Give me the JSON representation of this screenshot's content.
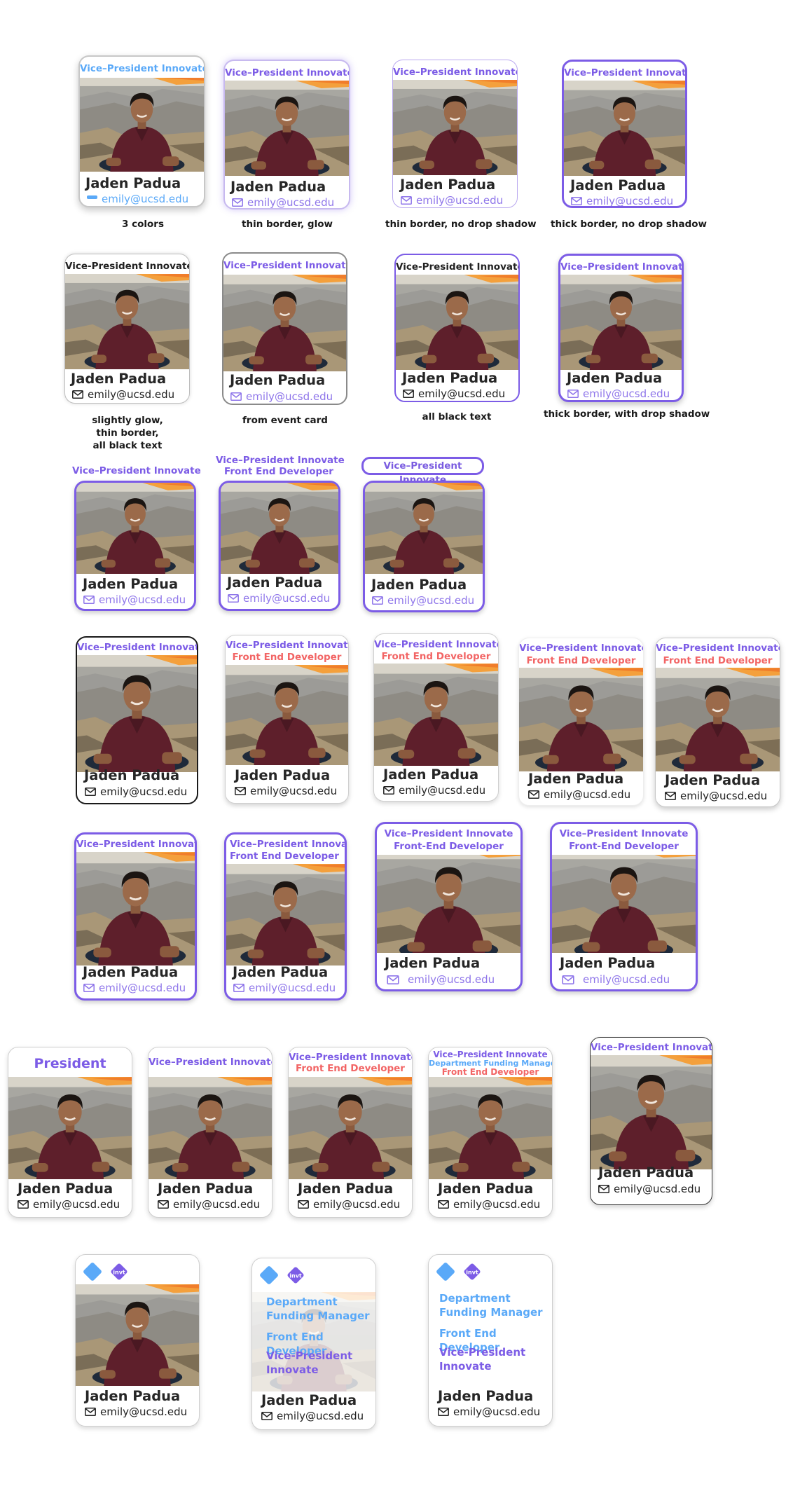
{
  "person": {
    "name": "Jaden Padua",
    "email": "emily@ucsd.edu"
  },
  "roles": {
    "vp": "Vice-President Innovate",
    "vp_hyphen": "Vice–President Innovate",
    "fed": "Front End Developer",
    "fed_hyphen": "Front-End Developer",
    "president": "President",
    "dfm": "Department Funding Manager",
    "dept_line1": "Department",
    "dept_line2": "Funding Manager",
    "vp_line1": "Vice-President",
    "vp_line2": "Innovate"
  },
  "badges": {
    "invt": "invt"
  },
  "captions": {
    "c1": "3 colors",
    "c2": "thin border, glow",
    "c3": "thin border, no drop shadow",
    "c4": "thick border, no drop shadow",
    "c5_1": "slightly glow,",
    "c5_2": "thin border,",
    "c5_3": "all black text",
    "c6": "from event card",
    "c7": "all black text",
    "c8": "thick border, with drop shadow"
  },
  "colors": {
    "purple": "#7c5ce6",
    "blue": "#5aa9f8",
    "coral": "#f26565",
    "text": "#262626"
  },
  "icons": [
    "mail-icon",
    "photo-portrait",
    "diamond-icon",
    "invt-badge-icon"
  ]
}
